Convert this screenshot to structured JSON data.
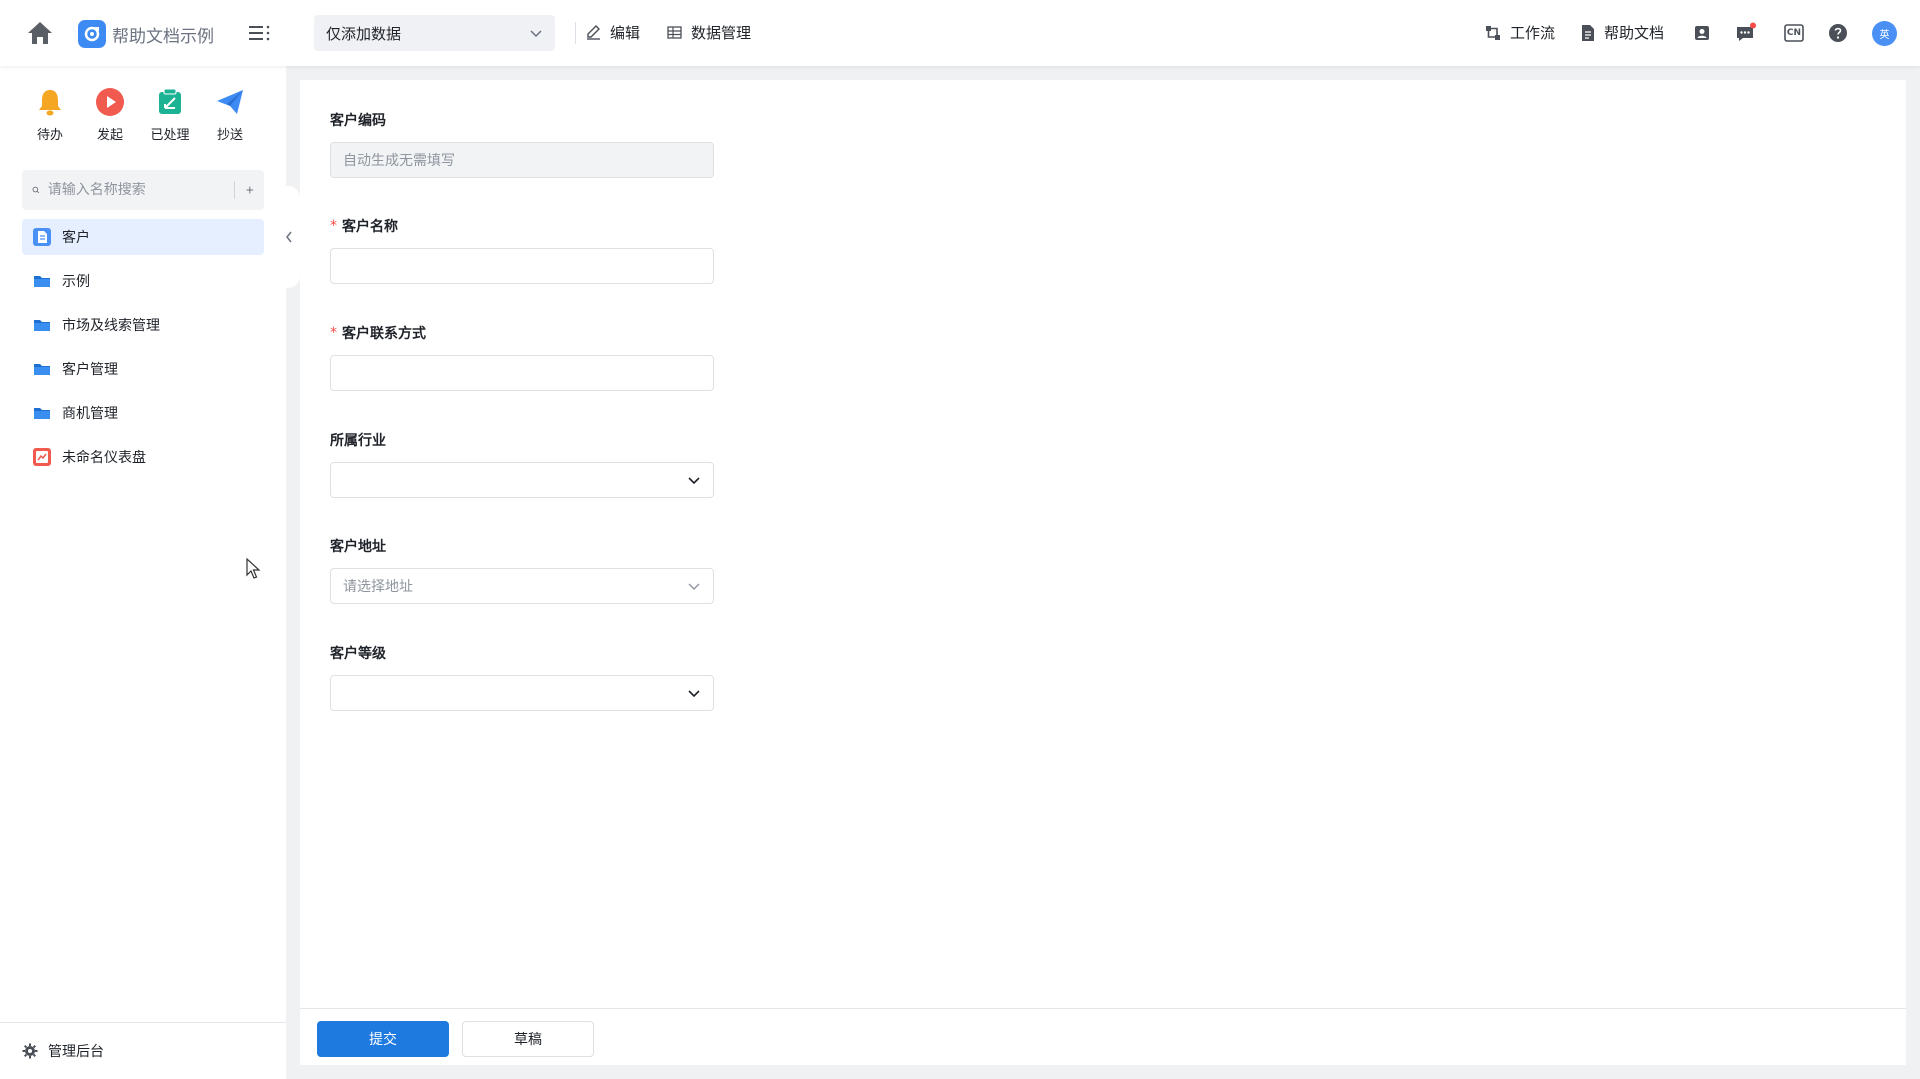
{
  "header": {
    "app_title": "帮助文档示例",
    "view_select": "仅添加数据",
    "edit_label": "编辑",
    "data_manage_label": "数据管理",
    "workflow_label": "工作流",
    "help_doc_label": "帮助文档",
    "lang_label": "CN",
    "avatar_text": "英"
  },
  "sidebar": {
    "quick": [
      {
        "label": "待办",
        "icon": "bell-icon",
        "color": "#f5a623"
      },
      {
        "label": "发起",
        "icon": "play-icon",
        "color": "#f05a4f"
      },
      {
        "label": "已处理",
        "icon": "processed-icon",
        "color": "#1bb394"
      },
      {
        "label": "抄送",
        "icon": "send-icon",
        "color": "#3d8bf2"
      }
    ],
    "search_placeholder": "请输入名称搜索",
    "items": [
      {
        "label": "客户",
        "icon": "form-icon",
        "active": true
      },
      {
        "label": "示例",
        "icon": "folder-icon"
      },
      {
        "label": "市场及线索管理",
        "icon": "folder-icon"
      },
      {
        "label": "客户管理",
        "icon": "folder-icon"
      },
      {
        "label": "商机管理",
        "icon": "folder-icon"
      },
      {
        "label": "未命名仪表盘",
        "icon": "dashboard-icon"
      }
    ],
    "footer_label": "管理后台"
  },
  "form": {
    "fields": [
      {
        "label": "客户编码",
        "required": false,
        "type": "text",
        "value": "",
        "placeholder": "自动生成无需填写",
        "disabled": true
      },
      {
        "label": "客户名称",
        "required": true,
        "type": "text",
        "value": "",
        "placeholder": ""
      },
      {
        "label": "客户联系方式",
        "required": true,
        "type": "text",
        "value": "",
        "placeholder": ""
      },
      {
        "label": "所属行业",
        "required": false,
        "type": "select",
        "value": "",
        "placeholder": ""
      },
      {
        "label": "客户地址",
        "required": false,
        "type": "select",
        "value": "",
        "placeholder": "请选择地址"
      },
      {
        "label": "客户等级",
        "required": false,
        "type": "select",
        "value": "",
        "placeholder": ""
      }
    ],
    "submit_label": "提交",
    "draft_label": "草稿"
  },
  "colors": {
    "primary": "#1f7ae0",
    "required": "#f54a45",
    "active_nav": "#e6efff"
  }
}
